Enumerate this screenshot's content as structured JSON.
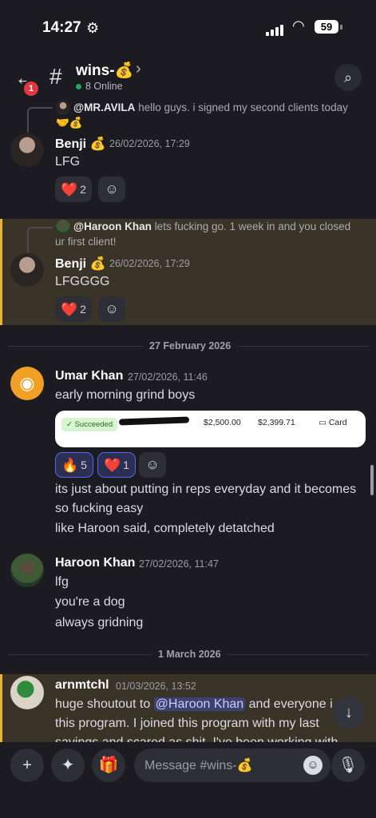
{
  "status_bar": {
    "time": "14:27",
    "battery": "59"
  },
  "header": {
    "back_badge": "1",
    "channel_name": "wins-💰",
    "online_text": "8 Online"
  },
  "messages": [
    {
      "reply_name": "@MR.AVILA",
      "reply_text": "hello guys. i signed my second clients today",
      "reply_cont": "🤝💰",
      "author": "Benji 💰",
      "timestamp": "26/02/2026, 17:29",
      "lines": [
        "LFG"
      ],
      "reactions": [
        {
          "emoji": "❤️",
          "count": "2"
        }
      ]
    },
    {
      "reply_name": "@Haroon Khan",
      "reply_text": "lets fucking go. 1 week in and you closed",
      "reply_cont": "ur first client!",
      "author": "Benji 💰",
      "timestamp": "26/02/2026, 17:29",
      "lines": [
        "LFGGGG"
      ],
      "reactions": [
        {
          "emoji": "❤️",
          "count": "2"
        }
      ]
    },
    {
      "author": "Umar Khan",
      "timestamp": "27/02/2026, 11:46",
      "lines": [
        "early morning grind boys",
        "its just about putting in reps everyday and it becomes",
        "so fucking easy",
        "like Haroon said, completely detatched"
      ],
      "embed": {
        "status": "✓ Succeeded",
        "amount": "$2,500.00",
        "net": "$2,399.71",
        "method": "Card"
      },
      "reactions": [
        {
          "emoji": "🔥",
          "count": "5"
        },
        {
          "emoji": "❤️",
          "count": "1"
        }
      ]
    },
    {
      "author": "Haroon Khan",
      "timestamp": "27/02/2026, 11:47",
      "lines": [
        "lfg",
        "you're a dog",
        "always gridning"
      ]
    },
    {
      "author": "arnmtchl",
      "timestamp": "01/03/2026, 13:52",
      "lines": [
        "huge shoutout to",
        "@Haroon Khan",
        "and everyone i",
        "this program. I joined this program with my last",
        "savings and scared as shit. I've been working with"
      ]
    }
  ],
  "date_dividers": [
    "27 February 2026",
    "1 March 2026"
  ],
  "composer": {
    "placeholder": "Message #wins-💰"
  }
}
